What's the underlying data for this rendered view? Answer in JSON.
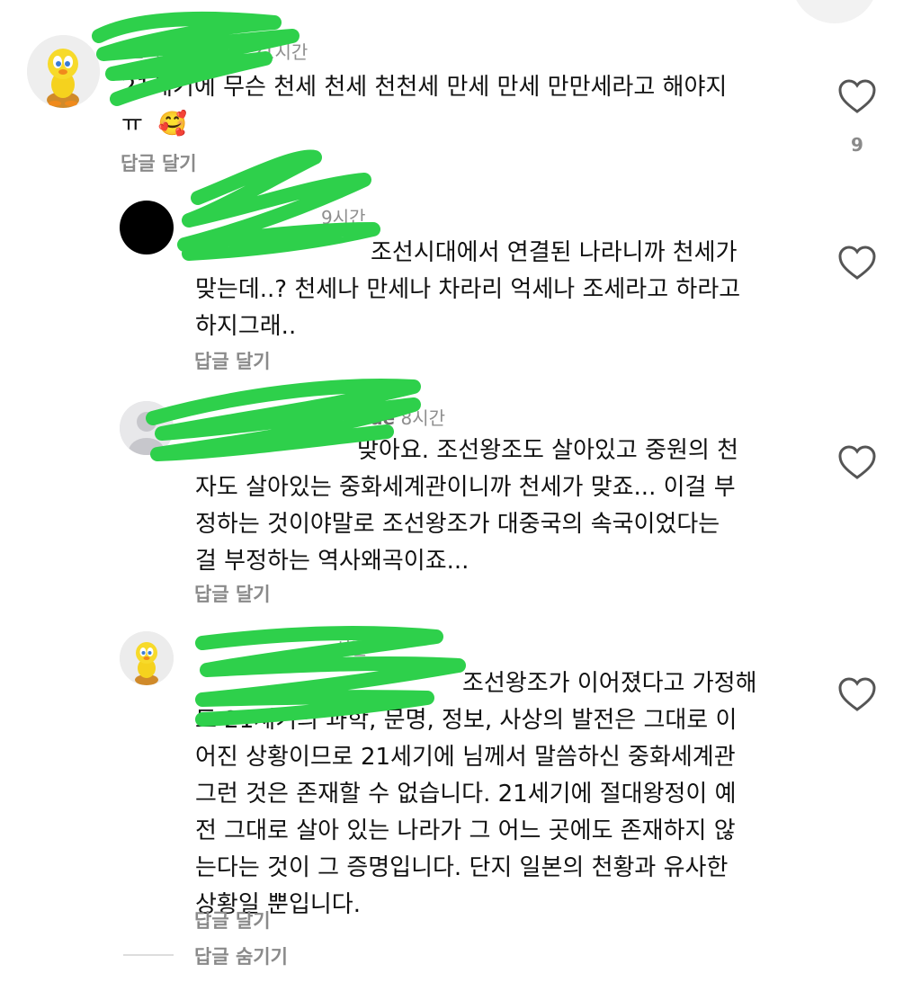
{
  "comments": [
    {
      "username": "",
      "time": "21시간",
      "text": "21세기에 무슨 천세 천세 천천세 만세 만세 만만세라고 해야지",
      "text2": "ㅠ",
      "emoji": "🥰",
      "reply_label": "답글 달기",
      "like_count": "9",
      "avatar_icon": "tweety-avatar-icon"
    }
  ],
  "replies": [
    {
      "username": "",
      "time": "9시간",
      "mention": "",
      "lines": [
        "조선시대에서 연결된 나라니까 천세가",
        "맞는데..? 천세나 만세나 차라리 억세나 조세라고 하라고",
        "하지그래.."
      ],
      "reply_label": "답글 달기",
      "avatar_icon": "black-avatar-icon"
    },
    {
      "username": "ude",
      "time": "8시간",
      "mention": "",
      "lines": [
        "맞아요. 조선왕조도 살아있고 중원의 천",
        "자도 살아있는 중화세계관이니까 천세가 맞죠... 이걸 부",
        "정하는 것이야말로 조선왕조가 대중국의 속국이었다는",
        "걸 부정하는 역사왜곡이죠..."
      ],
      "reply_label": "답글 달기",
      "avatar_icon": "default-avatar-icon"
    },
    {
      "username": "",
      "time": "시간",
      "mention": "",
      "lines": [
        "조선왕조가 이어졌다고 가정해",
        "도 21세기의 과학, 문명, 정보, 사상의 발전은 그대로 이",
        "어진 상황이므로 21세기에 님께서 말씀하신 중화세계관",
        "그런 것은 존재할 수 없습니다. 21세기에 절대왕정이 예",
        "전 그대로 살아 있는 나라가 그 어느 곳에도 존재하지 않",
        "는다는 것이 그 증명입니다. 단지 일본의 천황과 유사한",
        "상황일 뿐입니다."
      ],
      "reply_label": "답글 달기",
      "avatar_icon": "tweety-avatar-icon"
    }
  ],
  "hide_replies_label": "답글 숨기기",
  "colors": {
    "redaction": "#2ed04b",
    "mention": "#3b5b95",
    "meta": "#8e8e8e"
  }
}
